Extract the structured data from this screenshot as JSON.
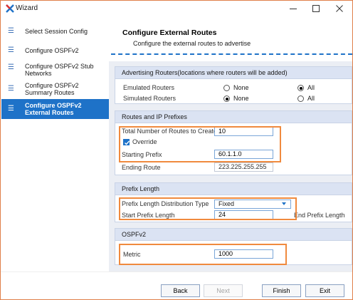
{
  "window": {
    "title": "Wizard",
    "icons": {
      "app": "x-logo-icon",
      "minimize": "minimize-icon",
      "maximize": "maximize-icon",
      "close": "close-icon"
    }
  },
  "sidebar": {
    "items": [
      {
        "label": "Select Session Config",
        "icon": "menu-icon",
        "active": false
      },
      {
        "label": "Configure OSPFv2",
        "icon": "menu-icon",
        "active": false
      },
      {
        "label": "Configure OSPFv2 Stub Networks",
        "icon": "menu-icon",
        "active": false
      },
      {
        "label": "Configure OSPFv2 Summary Routes",
        "icon": "menu-icon",
        "active": false
      },
      {
        "label": "Configure OSPFv2 External Routes",
        "icon": "menu-icon",
        "active": true
      }
    ]
  },
  "header": {
    "title": "Configure External Routes",
    "subtitle": "Configure the external routes to advertise"
  },
  "advertising": {
    "title": "Advertising Routers(locations where routers will be added)",
    "rows": [
      {
        "label": "Emulated Routers",
        "opt1": "None",
        "opt2": "All",
        "selected": "All"
      },
      {
        "label": "Simulated Routers",
        "opt1": "None",
        "opt2": "All",
        "selected": "None"
      }
    ]
  },
  "routes": {
    "title": "Routes and IP Prefixes",
    "total_label": "Total Number of Routes to Create",
    "total_value": "10",
    "override_label": "Override",
    "override_checked": true,
    "start_prefix_label": "Starting Prefix",
    "start_prefix_value": "60.1.1.0",
    "ending_route_label": "Ending Route",
    "ending_route_value": "223.225.255.255"
  },
  "prefix_length": {
    "title": "Prefix Length",
    "dist_label": "Prefix Length Distribution Type",
    "dist_value": "Fixed",
    "start_label": "Start Prefix Length",
    "start_value": "24",
    "end_label": "End Prefix Length"
  },
  "ospf": {
    "title": "OSPFv2",
    "metric_label": "Metric",
    "metric_value": "1000"
  },
  "footer": {
    "back": "Back",
    "next": "Next",
    "finish": "Finish",
    "exit": "Exit"
  },
  "colors": {
    "accent": "#1e72c8",
    "highlight": "#f08a3e",
    "panel": "#ebeef4"
  }
}
